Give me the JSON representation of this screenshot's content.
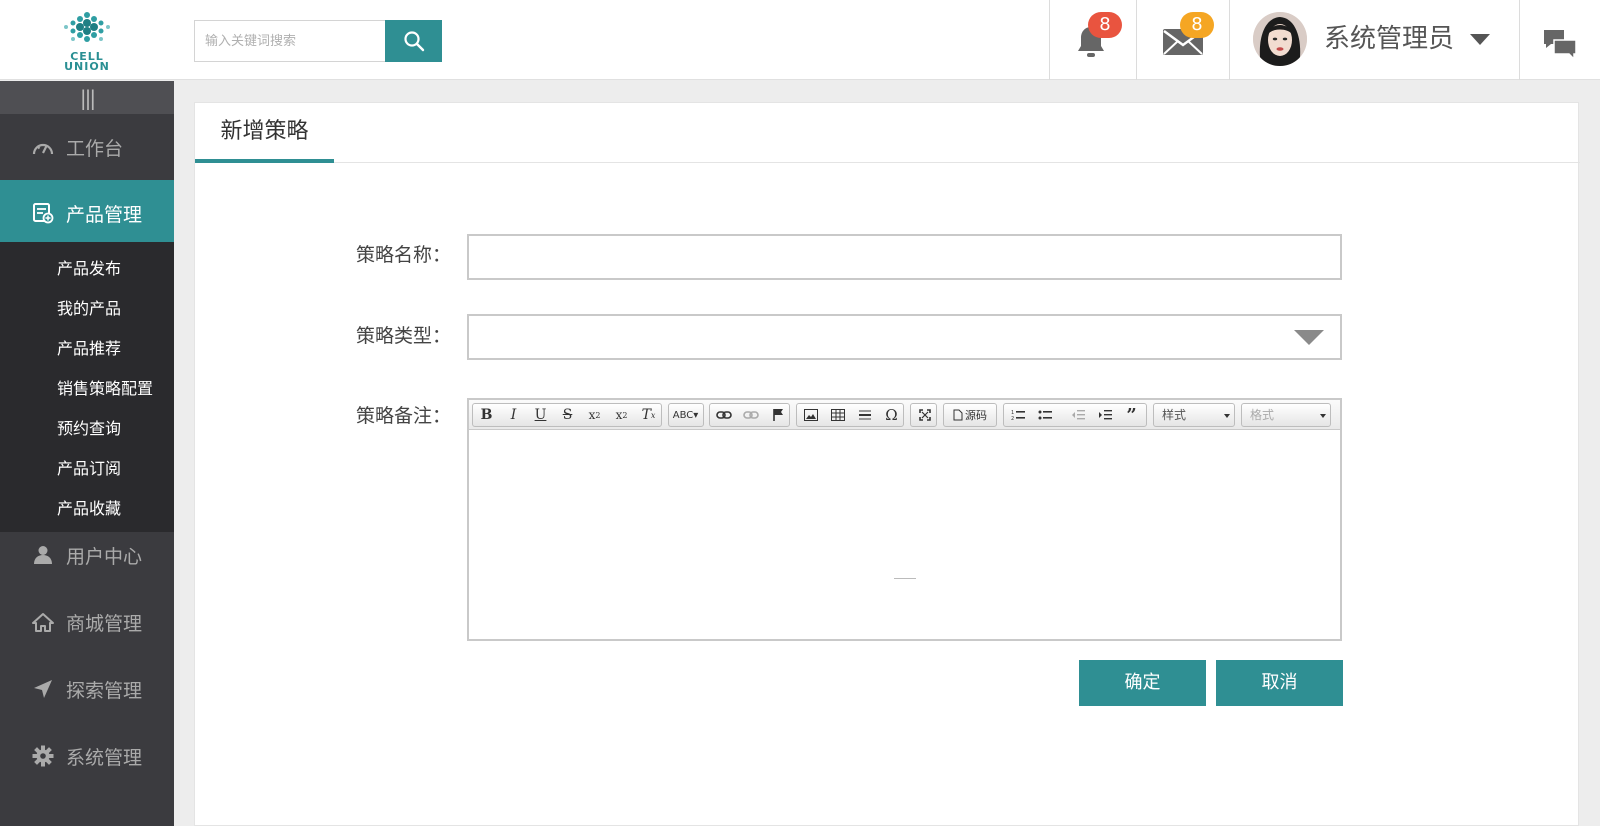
{
  "header": {
    "logo_text": [
      "CELL",
      "UNION"
    ],
    "search_placeholder": "输入关键词搜索",
    "notifications_count": "8",
    "messages_count": "8",
    "user_name": "系统管理员"
  },
  "sidebar": {
    "collapse_glyph": "|||",
    "items": [
      {
        "label": "工作台",
        "icon": "speedometer-icon"
      },
      {
        "label": "产品管理",
        "icon": "product-list-icon",
        "active": true
      },
      {
        "label": "用户中心",
        "icon": "user-icon"
      },
      {
        "label": "商城管理",
        "icon": "home-icon"
      },
      {
        "label": "探索管理",
        "icon": "navigate-icon"
      },
      {
        "label": "系统管理",
        "icon": "gear-icon"
      }
    ],
    "submenu": [
      "产品发布",
      "我的产品",
      "产品推荐",
      "销售策略配置",
      "预约查询",
      "产品订阅",
      "产品收藏"
    ]
  },
  "panel": {
    "tab_title": "新增策略",
    "form": {
      "name_label": "策略名称：",
      "name_value": "",
      "type_label": "策略类型：",
      "type_value": "",
      "remark_label": "策略备注："
    },
    "editor": {
      "source_label": "源码",
      "style_combo": "样式",
      "format_combo": "格式"
    },
    "confirm_label": "确定",
    "cancel_label": "取消"
  },
  "colors": {
    "accent": "#2f8f93",
    "sidebar_bg": "#3b3b3f",
    "submenu_bg": "#2a2a2d",
    "badge_red": "#e9543f",
    "badge_orange": "#f5a623"
  }
}
